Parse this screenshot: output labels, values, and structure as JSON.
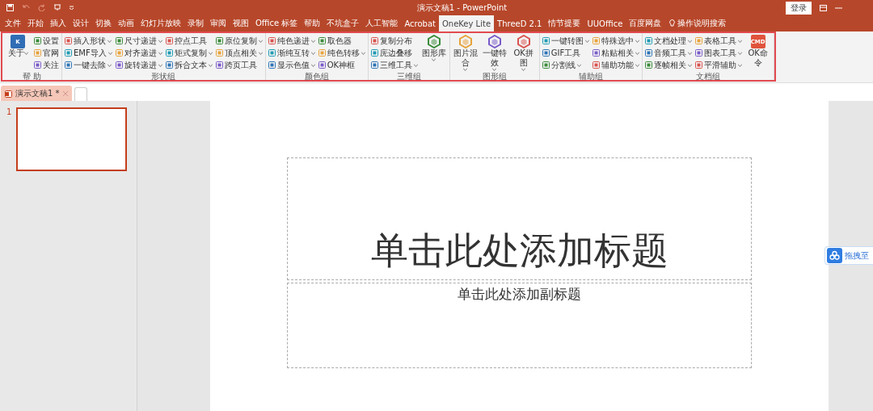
{
  "window": {
    "title": "演示文稿1  -  PowerPoint",
    "login": "登录"
  },
  "tabs": [
    {
      "label": "文件",
      "selected": false
    },
    {
      "label": "开始",
      "selected": false
    },
    {
      "label": "插入",
      "selected": false
    },
    {
      "label": "设计",
      "selected": false
    },
    {
      "label": "切换",
      "selected": false
    },
    {
      "label": "动画",
      "selected": false
    },
    {
      "label": "幻灯片放映",
      "selected": false
    },
    {
      "label": "录制",
      "selected": false
    },
    {
      "label": "审阅",
      "selected": false
    },
    {
      "label": "视图",
      "selected": false
    },
    {
      "label": "Office 标签",
      "selected": false
    },
    {
      "label": "帮助",
      "selected": false
    },
    {
      "label": "不坑盒子",
      "selected": false
    },
    {
      "label": "人工智能",
      "selected": false
    },
    {
      "label": "Acrobat",
      "selected": false
    },
    {
      "label": "OneKey Lite",
      "selected": true
    },
    {
      "label": "ThreeD 2.1",
      "selected": false
    },
    {
      "label": "情节提要",
      "selected": false
    },
    {
      "label": "UUOffice",
      "selected": false
    },
    {
      "label": "百度网盘",
      "selected": false
    }
  ],
  "tell_me": "操作说明搜索",
  "ribbon": {
    "groups": [
      {
        "name": "帮 助",
        "columns": [
          [
            {
              "kind": "large",
              "label": "关于",
              "icon_text": "K",
              "dropdown": true
            }
          ],
          [
            {
              "kind": "small",
              "label": "设置",
              "dropdown": false
            },
            {
              "kind": "small",
              "label": "官网",
              "dropdown": false
            },
            {
              "kind": "small",
              "label": "关注",
              "dropdown": false
            }
          ]
        ]
      },
      {
        "name": "形状组",
        "columns": [
          [
            {
              "kind": "small",
              "label": "插入形状",
              "dropdown": true
            },
            {
              "kind": "small",
              "label": "EMF导入",
              "dropdown": true
            },
            {
              "kind": "small",
              "label": "一键去除",
              "dropdown": true
            }
          ],
          [
            {
              "kind": "small",
              "label": "尺寸递进",
              "dropdown": true
            },
            {
              "kind": "small",
              "label": "对齐递进",
              "dropdown": true
            },
            {
              "kind": "small",
              "label": "旋转递进",
              "dropdown": true
            }
          ],
          [
            {
              "kind": "small",
              "label": "控点工具",
              "dropdown": false
            },
            {
              "kind": "small",
              "label": "矩式复制",
              "dropdown": true
            },
            {
              "kind": "small",
              "label": "拆合文本",
              "dropdown": true
            }
          ],
          [
            {
              "kind": "small",
              "label": "原位复制",
              "dropdown": true
            },
            {
              "kind": "small",
              "label": "顶点相关",
              "dropdown": true
            },
            {
              "kind": "small",
              "label": "跨页工具",
              "dropdown": false
            }
          ]
        ]
      },
      {
        "name": "颜色组",
        "columns": [
          [
            {
              "kind": "small",
              "label": "纯色递进",
              "dropdown": true
            },
            {
              "kind": "small",
              "label": "渐纯互转",
              "dropdown": true
            },
            {
              "kind": "small",
              "label": "显示色值",
              "dropdown": true
            }
          ],
          [
            {
              "kind": "small",
              "label": "取色器",
              "dropdown": false
            },
            {
              "kind": "small",
              "label": "纯色转移",
              "dropdown": true
            },
            {
              "kind": "small",
              "label": "OK神框",
              "dropdown": false
            }
          ]
        ]
      },
      {
        "name": "三维组",
        "columns": [
          [
            {
              "kind": "small",
              "label": "复制分布",
              "dropdown": false
            },
            {
              "kind": "small",
              "label": "庑边叠移",
              "dropdown": false
            },
            {
              "kind": "small",
              "label": "三维工具",
              "dropdown": true
            }
          ],
          [
            {
              "kind": "large",
              "label": "图形库",
              "dropdown": true
            }
          ]
        ]
      },
      {
        "name": "图形组",
        "columns": [
          [
            {
              "kind": "large",
              "label": "图片混合",
              "dropdown": true
            }
          ],
          [
            {
              "kind": "large",
              "label": "一键特效",
              "dropdown": true
            }
          ],
          [
            {
              "kind": "large",
              "label": "OK拼图",
              "dropdown": true
            }
          ]
        ]
      },
      {
        "name": "辅助组",
        "columns": [
          [
            {
              "kind": "small",
              "label": "一键转图",
              "dropdown": true
            },
            {
              "kind": "small",
              "label": "GIF工具",
              "dropdown": false
            },
            {
              "kind": "small",
              "label": "分割线",
              "dropdown": true
            }
          ],
          [
            {
              "kind": "small",
              "label": "特殊选中",
              "dropdown": true
            },
            {
              "kind": "small",
              "label": "粘贴相关",
              "dropdown": true
            },
            {
              "kind": "small",
              "label": "辅助功能",
              "dropdown": true
            }
          ]
        ]
      },
      {
        "name": "文档组",
        "columns": [
          [
            {
              "kind": "small",
              "label": "文档处理",
              "dropdown": true
            },
            {
              "kind": "small",
              "label": "音频工具",
              "dropdown": true
            },
            {
              "kind": "small",
              "label": "逐帧相关",
              "dropdown": true
            }
          ],
          [
            {
              "kind": "small",
              "label": "表格工具",
              "dropdown": true
            },
            {
              "kind": "small",
              "label": "图表工具",
              "dropdown": true
            },
            {
              "kind": "small",
              "label": "平滑辅助",
              "dropdown": true
            }
          ],
          [
            {
              "kind": "large",
              "label": "OK命令",
              "icon_text": "CMD",
              "dropdown": false
            }
          ]
        ]
      }
    ]
  },
  "doc_tabs": [
    {
      "label": "演示文稿1 *",
      "selected": true
    }
  ],
  "slides": [
    {
      "number": "1",
      "selected": true
    }
  ],
  "slide": {
    "title_placeholder": "单击此处添加标题",
    "subtitle_placeholder": "单击此处添加副标题"
  },
  "side_button": {
    "label": "拖拽至"
  }
}
